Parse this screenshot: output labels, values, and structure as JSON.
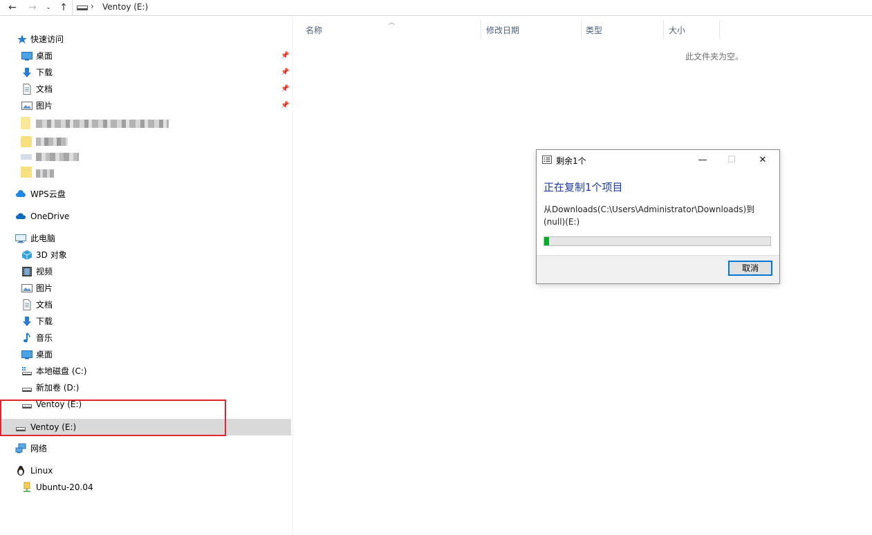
{
  "addressbar": {
    "path": "Ventoy (E:)",
    "separator": "›"
  },
  "sidebar": {
    "quick_access": {
      "label": "快速访问"
    },
    "quick_items": [
      {
        "label": "桌面"
      },
      {
        "label": "下载"
      },
      {
        "label": "文档"
      },
      {
        "label": "图片"
      }
    ],
    "wps": {
      "label": "WPS云盘"
    },
    "onedrive": {
      "label": "OneDrive"
    },
    "this_pc": {
      "label": "此电脑"
    },
    "pc_items": [
      {
        "label": "3D 对象"
      },
      {
        "label": "视频"
      },
      {
        "label": "图片"
      },
      {
        "label": "文档"
      },
      {
        "label": "下载"
      },
      {
        "label": "音乐"
      },
      {
        "label": "桌面"
      },
      {
        "label": "本地磁盘 (C:)"
      },
      {
        "label": "新加卷 (D:)"
      },
      {
        "label": "Ventoy (E:)"
      }
    ],
    "ventoy_root": {
      "label": "Ventoy (E:)"
    },
    "network": {
      "label": "网络"
    },
    "linux": {
      "label": "Linux"
    },
    "ubuntu": {
      "label": "Ubuntu-20.04"
    }
  },
  "content": {
    "columns": {
      "name": "名称",
      "modified": "修改日期",
      "type": "类型",
      "size": "大小"
    },
    "empty_message": "此文件夹为空。"
  },
  "dialog": {
    "title": "剩余1个",
    "heading": "正在复制1个项目",
    "description": "从Downloads(C:\\Users\\Administrator\\Downloads)到(null)(E:)",
    "progress": 0.02,
    "cancel": "取消",
    "buttons": {
      "minimize": "—",
      "maximize": "☐",
      "close": "✕"
    }
  },
  "colors": {
    "progress": "#06b025",
    "highlight": "#e0252c",
    "heading": "#1c3a9e",
    "selection": "#d9d9d9"
  }
}
